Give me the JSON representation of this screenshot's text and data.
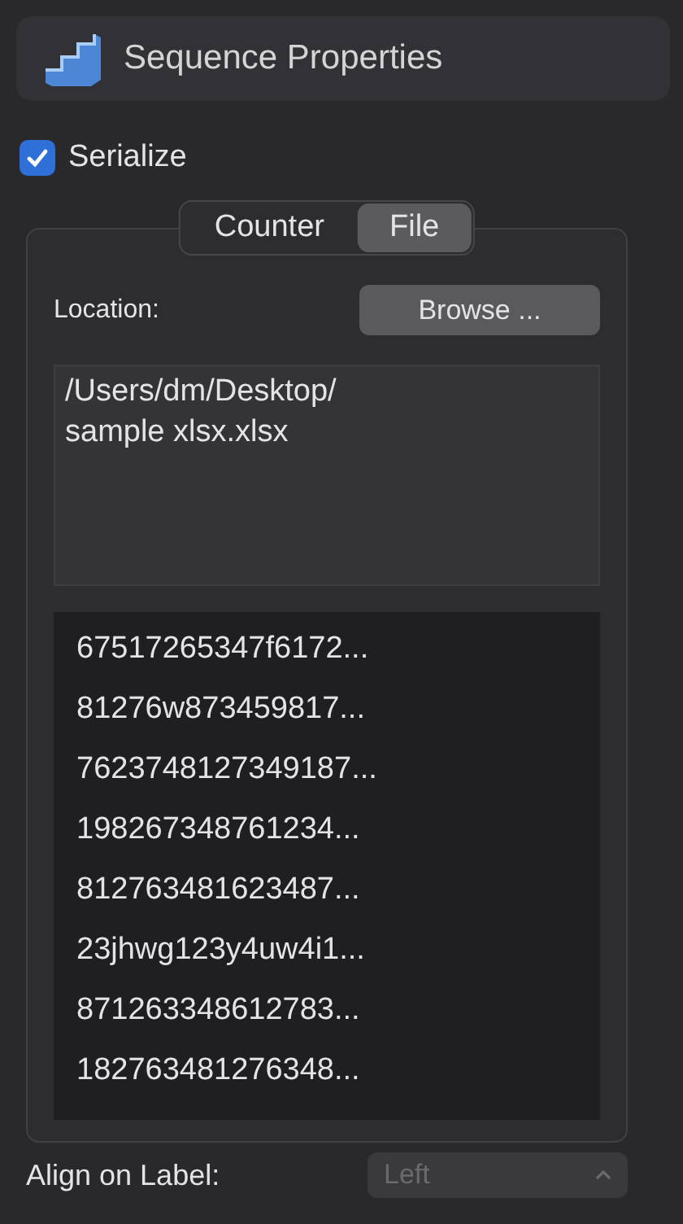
{
  "header": {
    "title": "Sequence Properties"
  },
  "serialize": {
    "label": "Serialize",
    "checked": true
  },
  "tabs": [
    {
      "label": "Counter",
      "selected": false
    },
    {
      "label": "File",
      "selected": true
    }
  ],
  "location": {
    "label": "Location:",
    "button": "Browse ...",
    "path": "/Users/dm/Desktop/\nsample xlsx.xlsx"
  },
  "values": [
    "67517265347f6172...",
    "81276w873459817...",
    "7623748127349187...",
    "198267348761234...",
    "812763481623487...",
    "23jhwg123y4uw4i1...",
    "871263348612783...",
    "182763481276348..."
  ],
  "align": {
    "label": "Align on Label:",
    "value": "Left",
    "disabled": true
  }
}
